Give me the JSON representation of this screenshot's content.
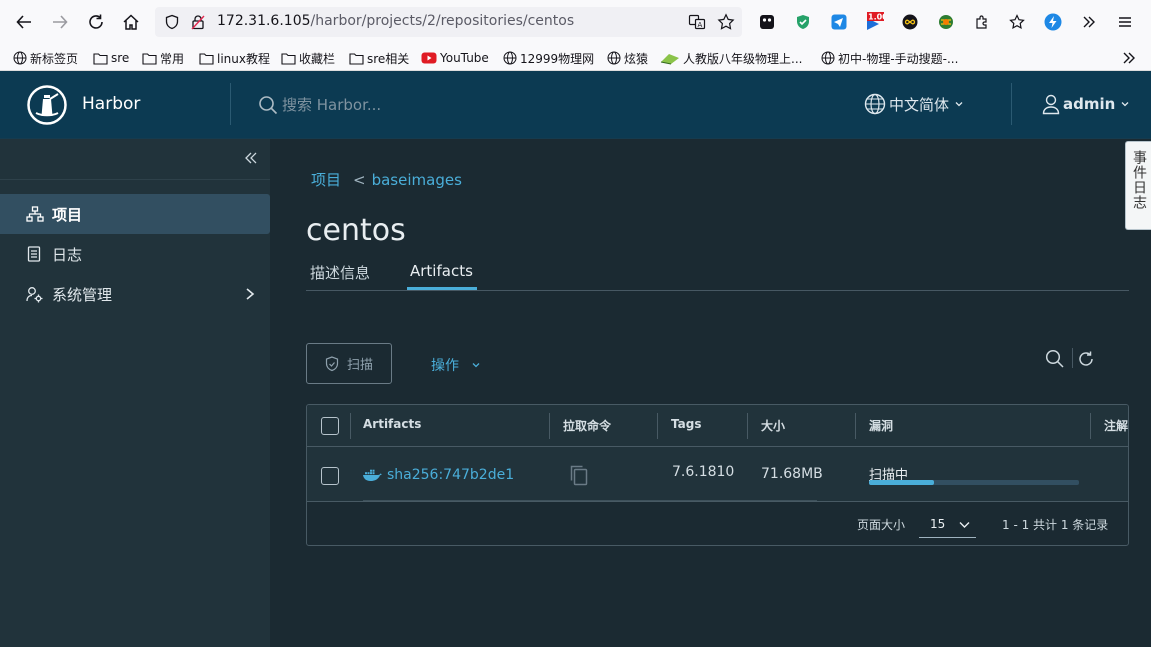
{
  "browser": {
    "url_host": "172.31.6.105",
    "url_path": "/harbor/projects/2/repositories/centos",
    "extension_badge": "1.00",
    "bookmarks": [
      {
        "label": "新标签页",
        "icon": "globe-icon"
      },
      {
        "label": "sre",
        "icon": "folder-icon"
      },
      {
        "label": "常用",
        "icon": "folder-icon"
      },
      {
        "label": "linux教程",
        "icon": "folder-icon"
      },
      {
        "label": "收藏栏",
        "icon": "folder-icon"
      },
      {
        "label": "sre相关",
        "icon": "folder-icon"
      },
      {
        "label": "YouTube",
        "icon": "youtube-icon"
      },
      {
        "label": "12999物理网",
        "icon": "globe-icon"
      },
      {
        "label": "炫猿",
        "icon": "globe-icon"
      },
      {
        "label": "人教版八年级物理上...",
        "icon": "book-icon"
      },
      {
        "label": "初中-物理-手动搜题-...",
        "icon": "globe-icon"
      }
    ]
  },
  "header": {
    "brand": "Harbor",
    "search_placeholder": "搜索 Harbor...",
    "language": "中文简体",
    "user": "admin"
  },
  "sidebar": {
    "items": [
      {
        "label": "项目",
        "icon": "projects-icon"
      },
      {
        "label": "日志",
        "icon": "logs-icon"
      },
      {
        "label": "系统管理",
        "icon": "admin-icon"
      }
    ]
  },
  "main": {
    "breadcrumb_root": "项目",
    "breadcrumb_sep": "<",
    "breadcrumb_project": "baseimages",
    "title": "centos",
    "tabs": [
      "描述信息",
      "Artifacts"
    ],
    "scan_button": "扫描",
    "actions_menu": "操作",
    "table": {
      "headers": [
        "Artifacts",
        "拉取命令",
        "Tags",
        "大小",
        "漏洞",
        "注解"
      ],
      "rows": [
        {
          "digest": "sha256:747b2de1",
          "tag": "7.6.1810",
          "size": "71.68MB",
          "vulnerability_status": "扫描中",
          "scan_progress": 0.31
        }
      ]
    },
    "footer": {
      "page_size_label": "页面大小",
      "page_size": "15",
      "count_text": "1 - 1 共计 1 条记录"
    }
  },
  "event_log_tab": "事件日志",
  "colors": {
    "accent": "#4aaed9",
    "header_bg": "#0c3a52",
    "content_bg": "#1b2a32",
    "sidebar_bg": "#21333b"
  }
}
